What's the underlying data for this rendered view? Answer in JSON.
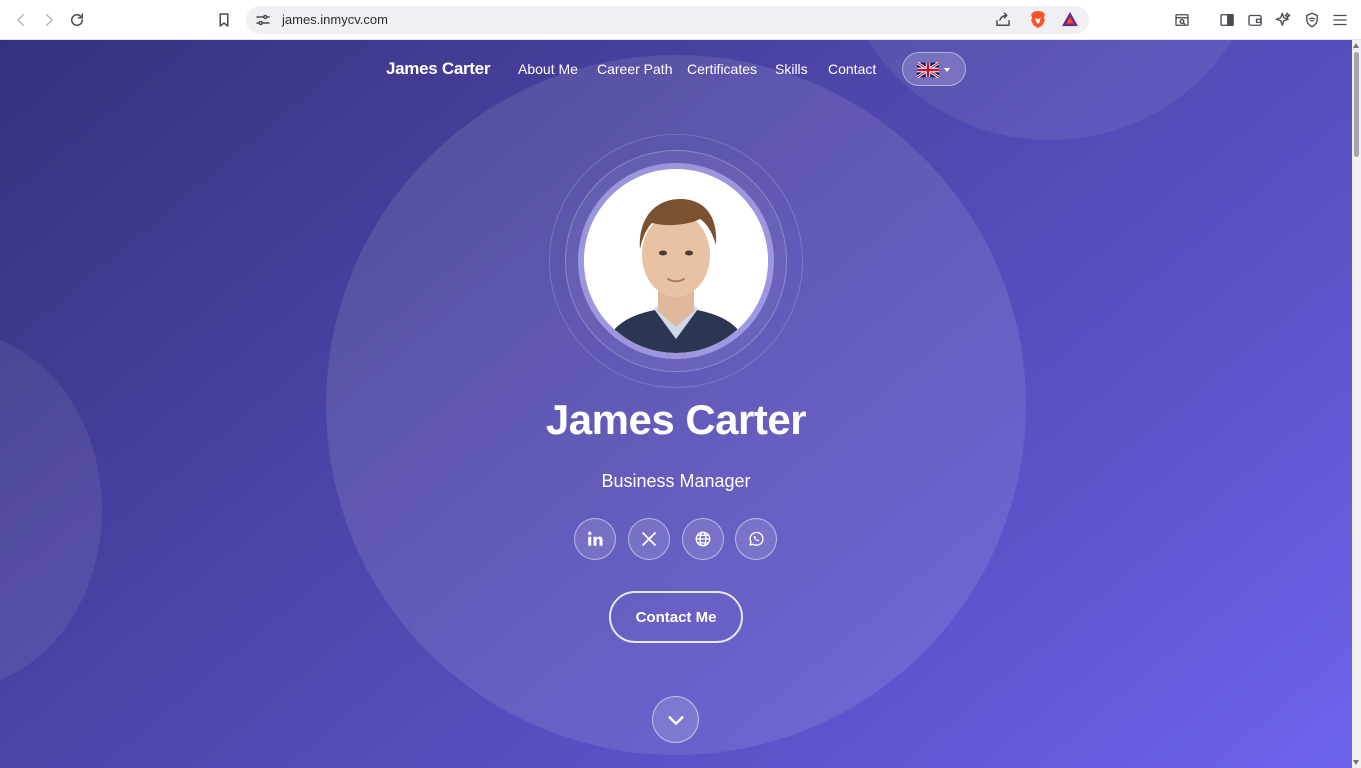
{
  "browser": {
    "url": "james.inmycv.com",
    "icons": [
      "back-icon",
      "forward-icon",
      "reload-icon",
      "bookmark-icon",
      "site-settings-icon",
      "share-icon",
      "brave-shields-icon",
      "brave-rewards-icon",
      "reader-mode-icon",
      "sidebar-icon",
      "wallet-icon",
      "leo-ai-icon",
      "vpn-icon",
      "menu-icon"
    ]
  },
  "nav": {
    "brand": "James Carter",
    "links": [
      "About Me",
      "Career Path",
      "Certificates",
      "Skills",
      "Contact"
    ],
    "language_flag": "uk-flag-icon"
  },
  "hero": {
    "name": "James Carter",
    "role": "Business Manager",
    "social": [
      "linkedin-icon",
      "x-icon",
      "globe-icon",
      "whatsapp-icon"
    ],
    "cta": "Contact Me"
  },
  "colors": {
    "gradient_start": "#35317c",
    "gradient_end": "#6e63ec",
    "text": "#ffffff"
  }
}
